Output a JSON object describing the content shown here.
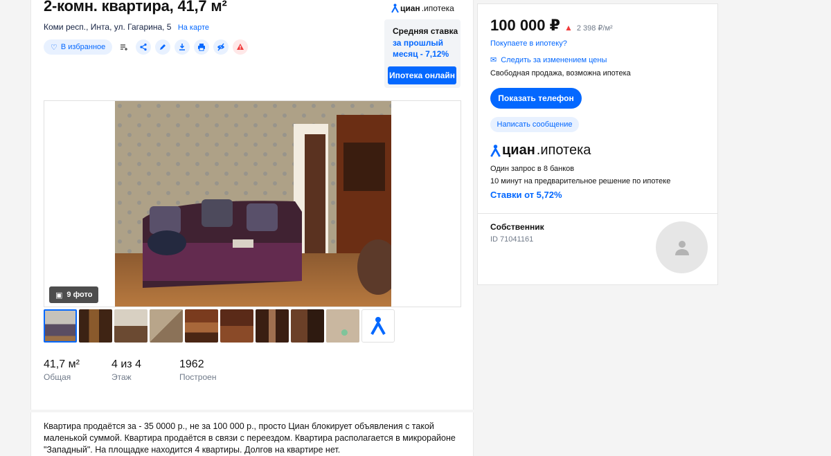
{
  "listing": {
    "title": "2-комн. квартира, 41,7 м²",
    "address": "Коми респ., Инта, ул. Гагарина, 5",
    "map_link": "На карте",
    "favorite_label": "В избранное"
  },
  "cian_promo": {
    "logo_bold": "циан",
    "logo_rest": ".ипотека",
    "rate_title": "Средняя ставка",
    "rate_text": "за прошлый месяц - 7,12%",
    "button_label": "Ипотека онлайн"
  },
  "gallery": {
    "photo_count": "9 фото",
    "thumbnail_count": 9
  },
  "stats": [
    {
      "value": "41,7 м²",
      "label": "Общая"
    },
    {
      "value": "4 из 4",
      "label": "Этаж"
    },
    {
      "value": "1962",
      "label": "Построен"
    }
  ],
  "description": "Квартира продаётся за - 35 0000 р., не за 100 000 р., просто Циан блокирует объявления с такой маленькой суммой. Квартира продаётся в связи с переездом. Квартира располагается в микрорайоне \"Западный\". На площадке находится 4 квартиры. Долгов на квартире нет.",
  "sidebar": {
    "price": "100 000 ₽",
    "price_per_m2": "2 398 ₽/м²",
    "mortgage_question": "Покупаете в ипотеку?",
    "track_price": "Следить за изменением цены",
    "sale_type": "Свободная продажа, возможна ипотека",
    "phone_button": "Показать телефон",
    "message_button": "Написать сообщение",
    "ipoteka_logo_bold": "циан",
    "ipoteka_logo_rest": ".ипотека",
    "banks_text": "Один запрос в 8 банков",
    "decision_text": "10 минут на предварительное решение по ипотеке",
    "rates_link": "Ставки от 5,72%",
    "owner_title": "Собственник",
    "owner_id": "ID 71041161"
  },
  "colors": {
    "accent": "#0468ff",
    "accent_light": "#e8f1ff",
    "warning": "#f03b3b",
    "muted_text": "#707a89"
  }
}
